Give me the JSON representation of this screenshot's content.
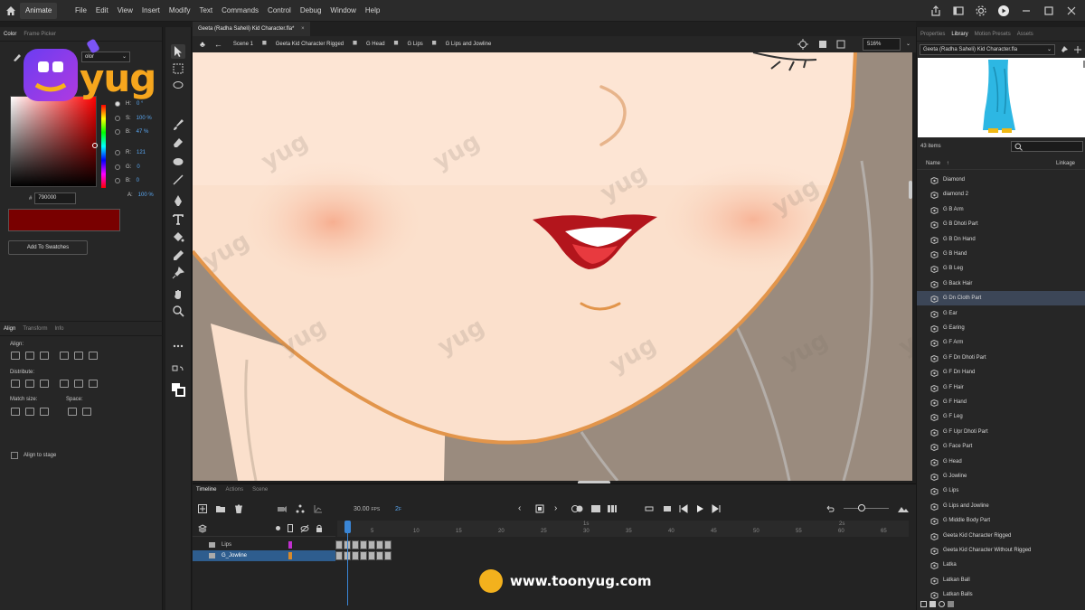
{
  "menubar": {
    "app_label": "Animate",
    "menus": [
      "File",
      "Edit",
      "View",
      "Insert",
      "Modify",
      "Text",
      "Commands",
      "Control",
      "Debug",
      "Window",
      "Help"
    ]
  },
  "left_panel": {
    "tabs": [
      "Color",
      "Frame Picker"
    ],
    "color_type": "olor",
    "hsb": [
      {
        "label": "H:",
        "value": "0 °"
      },
      {
        "label": "S:",
        "value": "100 %"
      },
      {
        "label": "B:",
        "value": "47 %"
      }
    ],
    "rgb": [
      {
        "label": "R:",
        "value": "121"
      },
      {
        "label": "G:",
        "value": "0"
      },
      {
        "label": "B:",
        "value": "0"
      }
    ],
    "alpha": {
      "label": "A:",
      "value": "100 %"
    },
    "hex_label": "#",
    "hex_value": "790000",
    "swatch_color": "#790000",
    "add_swatches_label": "Add To Swatches"
  },
  "align_panel": {
    "tabs": [
      "Align",
      "Transform",
      "Info"
    ],
    "align_label": "Align:",
    "distribute_label": "Distribute:",
    "match_size_label": "Match size:",
    "space_label": "Space:",
    "align_to_stage_label": "Align to stage"
  },
  "logo": {
    "text": "Ayug"
  },
  "document": {
    "tab_title": "Geeta (Radha Saheli) Kid Character.fla*",
    "close_glyph": "×",
    "breadcrumbs": [
      "Scene 1",
      "Geeta Kid Character Rigged",
      "G Head",
      "G Lips",
      "G Lips and Jowline"
    ],
    "zoom": "516%"
  },
  "watermark": {
    "text": "yug"
  },
  "timeline": {
    "tabs": [
      "Timeline",
      "Actions",
      "Scene"
    ],
    "fps": "30.00",
    "fps_unit": "FPS",
    "current_frame": "2",
    "frame_unit": "F",
    "second_markers": [
      "1s",
      "2s"
    ],
    "frame_numbers": [
      "5",
      "10",
      "15",
      "20",
      "25",
      "30",
      "35",
      "40",
      "45",
      "50",
      "55",
      "60",
      "65"
    ],
    "layers": [
      {
        "name": "Lips",
        "color": "#c02fcf",
        "selected": false
      },
      {
        "name": "G_Jowline",
        "color": "#d88a2b",
        "selected": true
      }
    ],
    "frame_count": 7
  },
  "right_panel": {
    "tabs": [
      "Properties",
      "Library",
      "Motion Presets",
      "Assets"
    ],
    "library_file": "Geeta (Radha Saheli) Kid Character.fla",
    "items_count": "43 items",
    "columns": {
      "name": "Name",
      "sort": "↑",
      "linkage": "Linkage"
    },
    "items": [
      "Diamond",
      "diamond 2",
      "G B Arm",
      "G B Dhoti Part",
      "G B Dn Hand",
      "G B Hand",
      "G B Leg",
      "G Back Hair",
      "G Dn Cloth Part",
      "G Ear",
      "G Earing",
      "G F Arm",
      "G F Dn Dhoti Part",
      "G F Dn Hand",
      "G F Hair",
      "G F Hand",
      "G F Leg",
      "G F Upr Dhoti Part",
      "G Face Part",
      "G Head",
      "G Jowline",
      "G Lips",
      "G Lips and Jowline",
      "G Middle Body Part",
      "Geeta Kid Character Rigged",
      "Geeta Kid Character Without Rigged",
      "Latka",
      "Latkan Ball",
      "Latkan Balls"
    ],
    "selected_item": "G Dn Cloth Part"
  },
  "url_badge": {
    "text": "www.toonyug.com"
  },
  "colors": {
    "accent_blue": "#3a86d6",
    "skin": "#fbe0cc",
    "lip_red": "#b3151c",
    "jaw_stroke": "#e2954b"
  }
}
